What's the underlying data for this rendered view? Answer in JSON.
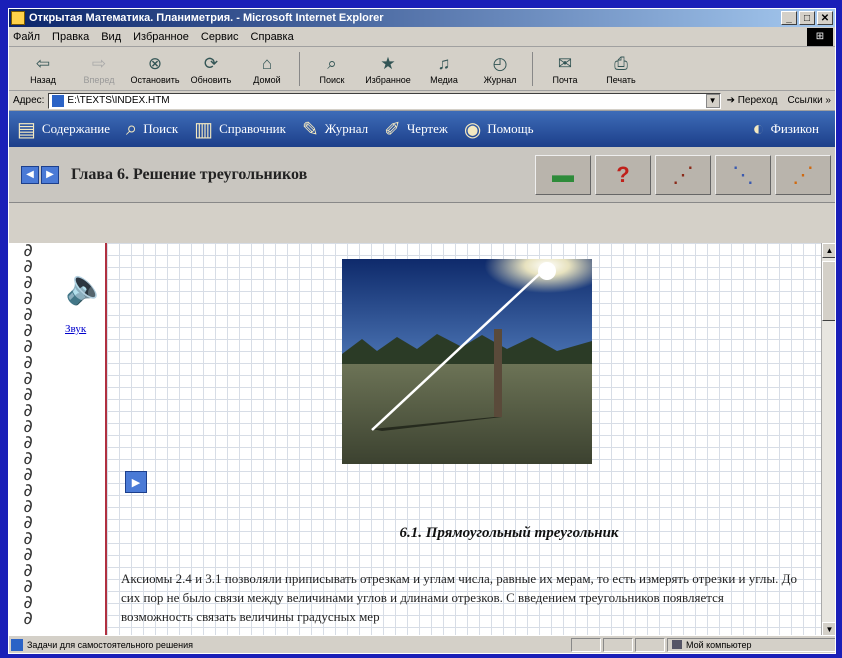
{
  "window": {
    "title": "Открытая Математика. Планиметрия. - Microsoft Internet Explorer",
    "minimize": "_",
    "maximize": "□",
    "close": "✕"
  },
  "menu": [
    "Файл",
    "Правка",
    "Вид",
    "Избранное",
    "Сервис",
    "Справка"
  ],
  "toolbar": {
    "buttons": [
      {
        "label": "Назад",
        "icon": "back-arrow-icon",
        "glyph": "⇦"
      },
      {
        "label": "Вперед",
        "icon": "forward-arrow-icon",
        "glyph": "⇨"
      },
      {
        "label": "Остановить",
        "icon": "stop-icon",
        "glyph": "⊗"
      },
      {
        "label": "Обновить",
        "icon": "refresh-icon",
        "glyph": "⟳"
      },
      {
        "label": "Домой",
        "icon": "home-icon",
        "glyph": "⌂"
      },
      {
        "label": "Поиск",
        "icon": "search-icon",
        "glyph": "⌕"
      },
      {
        "label": "Избранное",
        "icon": "favorites-icon",
        "glyph": "★"
      },
      {
        "label": "Медиа",
        "icon": "media-icon",
        "glyph": "♫"
      },
      {
        "label": "Журнал",
        "icon": "history-icon",
        "glyph": "◴"
      },
      {
        "label": "Почта",
        "icon": "mail-icon",
        "glyph": "✉"
      },
      {
        "label": "Печать",
        "icon": "print-icon",
        "glyph": "⎙"
      }
    ]
  },
  "address": {
    "label": "Адрес:",
    "value": "E:\\TEXTS\\INDEX.HTM",
    "go": "Переход",
    "links": "Ссылки »"
  },
  "sitenav": {
    "items": [
      {
        "label": "Содержание",
        "glyph": "▤"
      },
      {
        "label": "Поиск",
        "glyph": "⌕"
      },
      {
        "label": "Справочник",
        "glyph": "▥"
      },
      {
        "label": "Журнал",
        "glyph": "✎"
      },
      {
        "label": "Чертеж",
        "glyph": "✐"
      },
      {
        "label": "Помощь",
        "glyph": "◉"
      }
    ],
    "right_label": "Физикон",
    "right_glyph": "◐"
  },
  "chapter": {
    "title": "Глава 6. Решение треугольников",
    "prev": "◀",
    "next": "▶",
    "tools": [
      {
        "name": "book-icon",
        "glyph": "▬"
      },
      {
        "name": "question-icon",
        "glyph": "?"
      },
      {
        "name": "footprints-1-icon",
        "glyph": "⋰"
      },
      {
        "name": "footprints-2-icon",
        "glyph": "⋱"
      },
      {
        "name": "footprints-3-icon",
        "glyph": "⋰"
      }
    ]
  },
  "sidebar": {
    "sound_label": "Звук",
    "speaker_glyph": "🔈"
  },
  "content": {
    "play": "▶",
    "section_title": "6.1. Прямоугольный треугольник",
    "paragraph": "Аксиомы 2.4 и 3.1 позволяли приписывать отрезкам и углам числа, равные их мерам, то есть измерять отрезки и углы. До сих пор не было связи между величинами углов и длинами отрезков. С введением треугольников появляется возможность связать величины градусных мер"
  },
  "statusbar": {
    "text": "Задачи для самостоятельного решения",
    "zone": "Мой компьютер"
  }
}
